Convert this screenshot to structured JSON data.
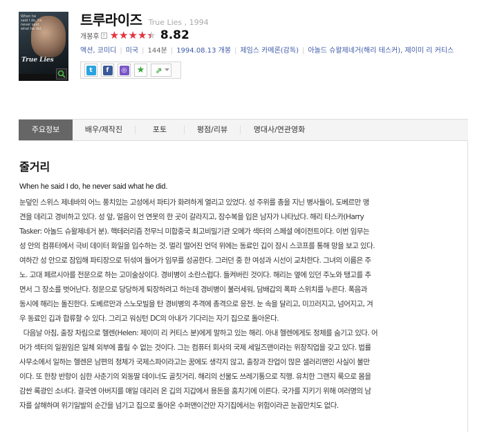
{
  "movie": {
    "title_ko": "트루라이즈",
    "title_en": "True Lies",
    "year": "1994",
    "rating_label": "개봉후",
    "rating_help": "?",
    "rating_fraction": 0.882,
    "score": "8.82",
    "stars_glyphs": "★★★★★"
  },
  "poster": {
    "top_text": "When he said I do, he never said what he did.",
    "title_text": "True Lies",
    "zoom_icon": "magnifier-icon"
  },
  "meta": {
    "genre": "액션, 코미디",
    "country": "미국",
    "runtime": "144분",
    "release": "1994.08.13 개봉",
    "director": "제임스 카메론(감독)",
    "cast": "아놀드 슈왈제네거(해리 테스커), 제이미 리 커티스"
  },
  "share": {
    "buttons": [
      {
        "name": "twitter",
        "glyph": "t",
        "color": "#2aa3e0"
      },
      {
        "name": "facebook",
        "glyph": "f",
        "color": "#3b5998"
      },
      {
        "name": "me2day",
        "glyph": "◎",
        "color": "#7a55c7"
      },
      {
        "name": "favorite",
        "glyph": "★",
        "color": "#3aa33a"
      },
      {
        "name": "more-share",
        "glyph": "⇗",
        "color": "#3aa33a"
      }
    ]
  },
  "tabs": [
    "주요정보",
    "배우/제작진",
    "포토",
    "평점/리뷰",
    "명대사/연관영화"
  ],
  "content": {
    "section_title": "줄거리",
    "tagline": "When he said I do, he never said what he did.",
    "synopsis_lines": [
      "눈덮인 스위스 제네바의 어느 풍치있는 고성에서 파티가 화려하게 열리고 있었다. 성 주위를 총을 지닌 병사들이, 도베르만 맹",
      "견을 데리고 경비하고 있다. 성 앞, 얼음이 언 연못의 한 곳이 갈라지고, 잠수복을 입은 남자가 나타났다. 해리 타스카(Harry",
      "Tasker: 아놀드 슈왈제네거 분). 핵테러리즘 전무늬 미합중국 최고비밀기관 오메가 섹터의 스페셜 에이전트이다. 이번 임무는",
      "성 안의 컴퓨터에서 극비 데이터 화일을 입수하는 것. 멀리 떨어진 언덕 위에는 동료인 깁이 잠시 스코프를 통해 망을 보고 있다.",
      "여하간 성 안으로 잠입해 파티장으로 뒤섞여 들어가 임무를 성공한다. 그러던 중 한 여성과 시선이 교차한다. 그녀의 이름은 주",
      "노. 고대 페르시아를 전문으로 하는 고미술상이다. 경비병이 소란스럽다. 들켜버린 것이다. 해리는 옆에 있던 주노와 탱고를 추",
      "면서 그 장소를 벗어난다. 정문으로 당당하게 퇴장하려고 하는데 경비병이 불러세워, 담배갑의 폭파 스위치를 누른다. 폭음과",
      "동시에 해리는 돌진한다. 도베르만과 스노모빌을 탄 경비병의 추격에 총격으로 응전. 눈 속을 달리고, 미끄러지고, 넘어지고, 겨",
      "우 동료인 깁과 합류할 수 있다. 그리고 워싱턴 DC의 아내가 기다리는 자기 집으로 돌아온다.",
      "  다음날 아침, 출장 차림으로 헬렌(Helen: 제이미 리 커티스 분)에게 말하고 있는 해리. 아내 헬렌에게도 정체를 숨기고 있다. 어",
      "머가 섹터의 일원임은 일체 외부에 흘릴 수 없는 것이다. 그는 컴퓨터 회사의 국제 세일즈맨이라는 위장직업을 갖고 있다. 법률",
      "사무소에서 일하는 헬렌은 남편의 정체가 국제스파이라고는 꿈에도 생각지 않고, 출장과 잔업이 많은 샐러리맨인 사실이 불만",
      "이다. 또 한창 반항이 심한 사춘기의 외동딸 데이너도 골칫거리. 해리의 선물도 쓰레기통으로 직행. 유치한 그랜지 룩으로 몸을",
      "감싼 록광인 소녀다. 결국엔 아버지를 매일 데리러 온 깁의 지갑에서 용돈을 훔치기에 이른다. 국가를 지키기 위해 여러명의 남",
      "자를 살해하며 위기일발의 순간을 넘기고 집으로 돌아온 수퍼맨이건만 자기집에서는 위험이라곤 눈꼽만치도 없다."
    ]
  }
}
